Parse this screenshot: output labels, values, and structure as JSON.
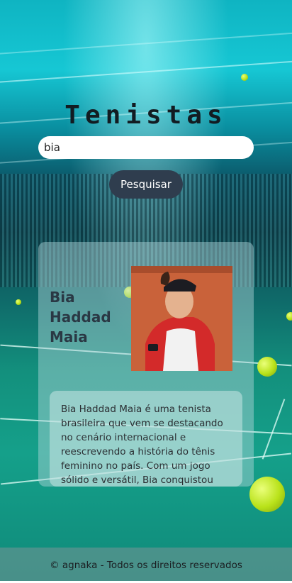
{
  "page": {
    "title": "Tenistas"
  },
  "search": {
    "value": "bia",
    "button_label": "Pesquisar"
  },
  "player": {
    "name": "Bia Haddad Maia",
    "description": "Bia Haddad Maia é uma tenista brasileira que vem se destacando no cenário internacional e reescrevendo a história do tênis feminino no país. Com um jogo sólido e versátil, Bia conquistou"
  },
  "footer": {
    "text": "© agnaka - Todos os direitos reservados"
  }
}
